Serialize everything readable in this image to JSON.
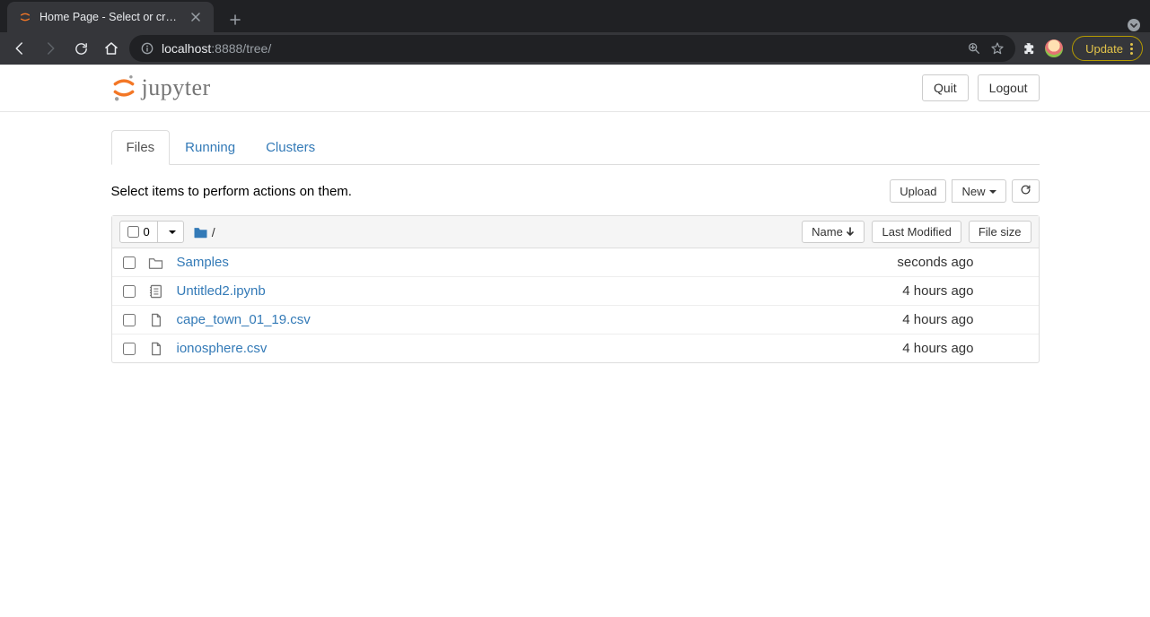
{
  "browser": {
    "tab_title": "Home Page - Select or create a",
    "url_host": "localhost",
    "url_rest": ":8888/tree/",
    "update_label": "Update"
  },
  "header": {
    "logo_text": "jupyter",
    "quit_label": "Quit",
    "logout_label": "Logout"
  },
  "tabs": {
    "files": "Files",
    "running": "Running",
    "clusters": "Clusters"
  },
  "actions": {
    "hint": "Select items to perform actions on them.",
    "upload_label": "Upload",
    "new_label": "New"
  },
  "list_header": {
    "selected_count": "0",
    "breadcrumb_sep": "/",
    "name_label": "Name",
    "modified_label": "Last Modified",
    "size_label": "File size"
  },
  "files": [
    {
      "type": "folder",
      "name": "Samples",
      "modified": "seconds ago",
      "size": ""
    },
    {
      "type": "notebook",
      "name": "Untitled2.ipynb",
      "modified": "4 hours ago",
      "size": ""
    },
    {
      "type": "file",
      "name": "cape_town_01_19.csv",
      "modified": "4 hours ago",
      "size": ""
    },
    {
      "type": "file",
      "name": "ionosphere.csv",
      "modified": "4 hours ago",
      "size": ""
    }
  ]
}
